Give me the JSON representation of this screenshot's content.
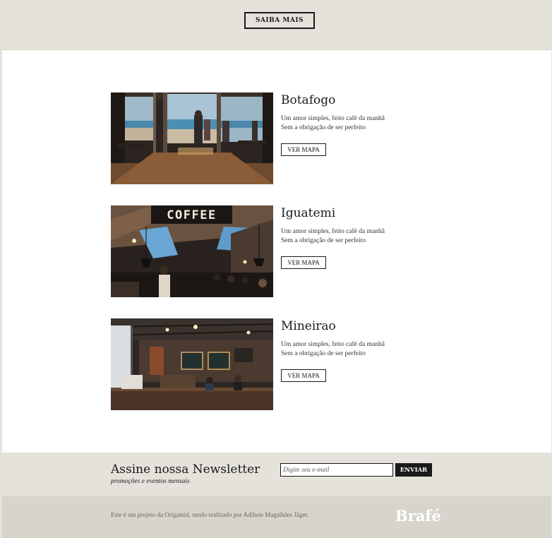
{
  "hero": {
    "cta_label": "SAIBA MAIS"
  },
  "locations": [
    {
      "name": "Botafogo",
      "desc_line1": "Um amor simples, feito café da manhã",
      "desc_line2": "Sem a obrigação de ser perfeito",
      "map_label": "VER MAPA",
      "image": "cafe-beach-view-photo"
    },
    {
      "name": "Iguatemi",
      "desc_line1": "Um amor simples, feito café da manhã",
      "desc_line2": "Sem a obrigação de ser perfeito",
      "map_label": "VER MAPA",
      "image": "coffee-sign-interior-photo",
      "sign_text": "COFFEE"
    },
    {
      "name": "Mineirao",
      "desc_line1": "Um amor simples, feito café da manhã",
      "desc_line2": "Sem a obrigação de ser perfeito",
      "map_label": "VER MAPA",
      "image": "cafe-counter-interior-photo"
    }
  ],
  "newsletter": {
    "title": "Assine nossa Newsletter",
    "subtitle": "promoções e eventos mensais",
    "input_placeholder": "Digite seu e-mail",
    "submit_label": "ENVIAR"
  },
  "footer": {
    "credit": "Este é um projeto da Origamid, sendo realizado por Adilson Magalhães Jäger.",
    "logo": "Brafé"
  },
  "colors": {
    "band": "#e4e2da",
    "footer": "#d6d4cb",
    "ink": "#1a1a1a"
  }
}
